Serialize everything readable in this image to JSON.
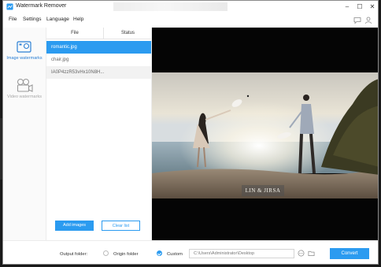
{
  "window": {
    "title": "Watermark Remover"
  },
  "menu": {
    "items": [
      "File",
      "Settings",
      "Language",
      "Help"
    ]
  },
  "sidebar": {
    "items": [
      {
        "label": "Image watermarks",
        "icon": "image-watermark-icon",
        "active": true
      },
      {
        "label": "Video watermarks",
        "icon": "video-camera-icon",
        "active": false
      }
    ]
  },
  "file_list": {
    "columns": [
      "File",
      "Status"
    ],
    "rows": [
      {
        "name": "romantic.jpg",
        "status": ""
      },
      {
        "name": "chair.jpg",
        "status": ""
      },
      {
        "name": "IA0P4zzR53vHx10N8H...",
        "status": ""
      }
    ],
    "add_button": "Add images",
    "clear_button": "Clear list"
  },
  "preview": {
    "watermark_text": "LIN & JIRSA"
  },
  "bottom": {
    "output_folder_label": "Output folder:",
    "origin_label": "Origin folder",
    "custom_label": "Custom",
    "path_value": "C:\\Users\\Administrator\\Desktop",
    "convert_button": "Convert"
  },
  "colors": {
    "accent": "#2b9bf0"
  }
}
